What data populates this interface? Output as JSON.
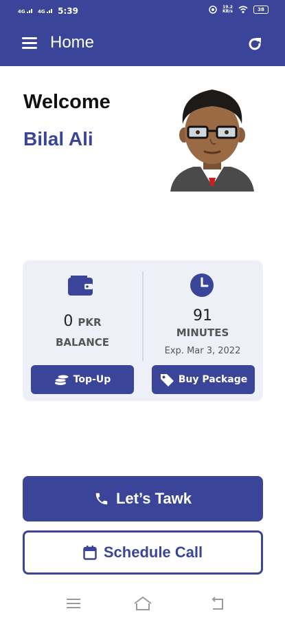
{
  "status_bar": {
    "network_1": "4G",
    "network_2": "4G",
    "time": "5:39",
    "speed_value": "19.2",
    "speed_unit": "KB/s",
    "battery": "38"
  },
  "header": {
    "title": "Home",
    "menu_icon": "hamburger-menu-icon",
    "refresh_icon": "refresh-icon"
  },
  "profile": {
    "greeting": "Welcome",
    "name": "Bilal Ali"
  },
  "balance": {
    "value": "0",
    "unit": "PKR",
    "label": "BALANCE",
    "button_label": "Top-Up"
  },
  "minutes": {
    "value": "91",
    "label": "MINUTES",
    "expiry": "Exp. Mar 3, 2022",
    "button_label": "Buy Package"
  },
  "actions": {
    "tawk_label": "Let’s Tawk",
    "schedule_label": "Schedule Call"
  },
  "colors": {
    "primary": "#3a4599",
    "card_bg": "#eef0f7"
  }
}
